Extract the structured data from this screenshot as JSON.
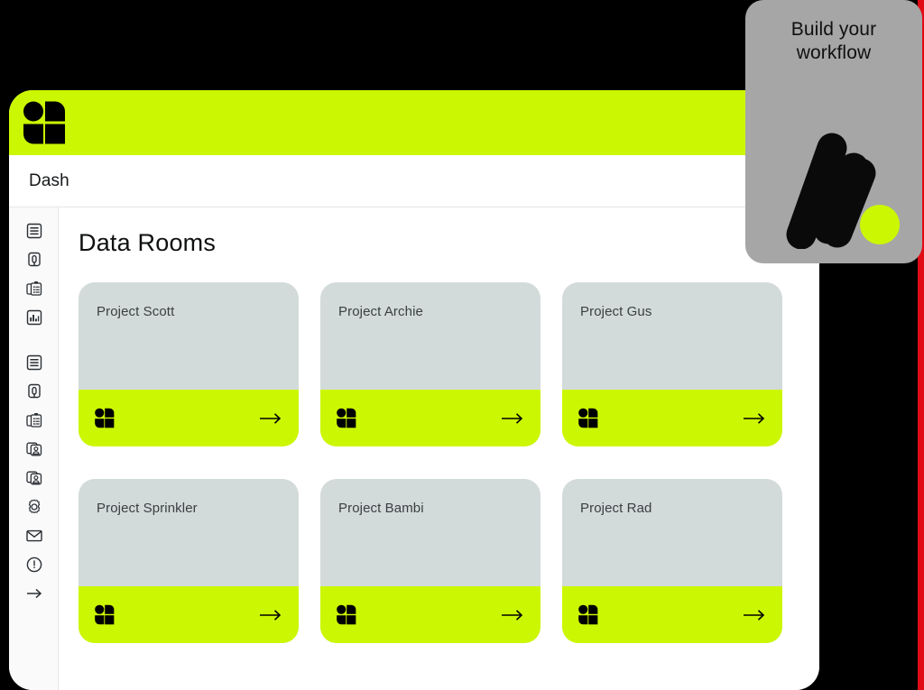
{
  "window": {
    "brand_logo_icon": "four-tile-logo-icon",
    "tab_label": "Dash"
  },
  "sidebar": {
    "group_one": [
      {
        "icon": "document-lines-icon",
        "name": "sidebar-item-documents"
      },
      {
        "icon": "q-card-icon",
        "name": "sidebar-item-questions"
      },
      {
        "icon": "clipboard-list-icon",
        "name": "sidebar-item-clipboard"
      },
      {
        "icon": "bar-chart-icon",
        "name": "sidebar-item-analytics"
      }
    ],
    "group_two": [
      {
        "icon": "document-lines-icon",
        "name": "sidebar-item-documents-2"
      },
      {
        "icon": "q-card-icon",
        "name": "sidebar-item-questions-2"
      },
      {
        "icon": "clipboard-copy-icon",
        "name": "sidebar-item-clipboard-2"
      },
      {
        "icon": "contact-cards-icon",
        "name": "sidebar-item-contacts"
      },
      {
        "icon": "contact-cards-icon",
        "name": "sidebar-item-contacts-2"
      },
      {
        "icon": "gear-icon",
        "name": "sidebar-item-settings"
      },
      {
        "icon": "envelope-icon",
        "name": "sidebar-item-mail"
      },
      {
        "icon": "exclamation-circle-icon",
        "name": "sidebar-item-alerts"
      },
      {
        "icon": "arrow-right-icon",
        "name": "sidebar-item-signout"
      }
    ]
  },
  "main": {
    "page_title": "Data Rooms",
    "cards": [
      {
        "title": "Project Scott"
      },
      {
        "title": "Project Archie"
      },
      {
        "title": "Project Gus"
      },
      {
        "title": "Project Sprinkler"
      },
      {
        "title": "Project Bambi"
      },
      {
        "title": "Project Rad"
      }
    ],
    "card_logo_icon": "four-tile-logo-icon",
    "card_arrow_icon": "arrow-right-icon"
  },
  "promo": {
    "line_one": "Build your",
    "line_two": "workflow",
    "logo_icon": "h-dot-logo-icon"
  },
  "colors": {
    "lime": "#CCF702",
    "card_grey": "#D3DBDA",
    "promo_grey": "#A6A6A6",
    "ink": "#0E1011",
    "red_strip": "#E00B15",
    "stage_black": "#000000"
  }
}
